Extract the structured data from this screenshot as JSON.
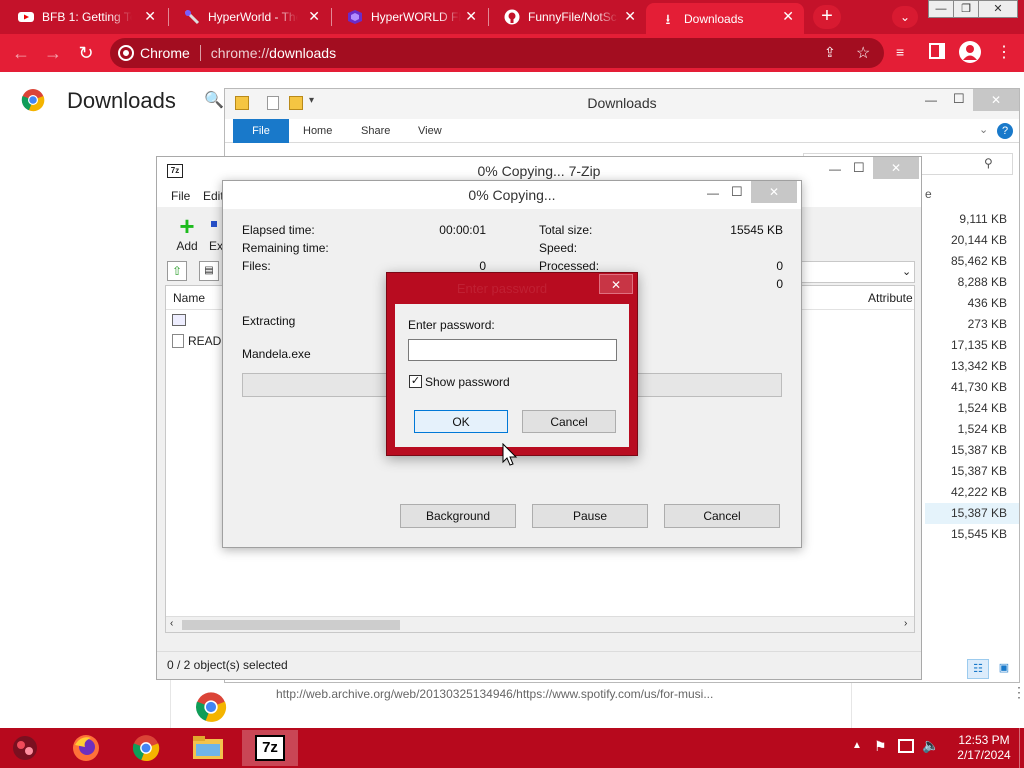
{
  "chrome": {
    "tabs": [
      {
        "title": "BFB 1: Getting Te",
        "icon": "youtube-icon"
      },
      {
        "title": "HyperWorld - The",
        "icon": "hyperworld-icon"
      },
      {
        "title": "HyperWORLD FE",
        "icon": "hyperworld-fe-icon"
      },
      {
        "title": "FunnyFile/NotSca",
        "icon": "github-icon"
      },
      {
        "title": "Downloads",
        "icon": "download-icon",
        "active": true
      }
    ],
    "site_chip": "Chrome",
    "url_prefix": "chrome://",
    "url_path": "downloads"
  },
  "downloads_page": {
    "title": "Downloads",
    "item_url": "http://web.archive.org/web/20130325134946/https://www.spotify.com/us/for-musi..."
  },
  "explorer": {
    "title": "Downloads",
    "ribbon_tabs": [
      "File",
      "Home",
      "Share",
      "View"
    ],
    "size_header": "e",
    "sizes": [
      "9,111 KB",
      "20,144 KB",
      "85,462 KB",
      "8,288 KB",
      "436 KB",
      "273 KB",
      "17,135 KB",
      "13,342 KB",
      "41,730 KB",
      "1,524 KB",
      "1,524 KB",
      "15,387 KB",
      "15,387 KB",
      "42,222 KB",
      "15,387 KB",
      "15,545 KB"
    ],
    "selected_index": 14
  },
  "zip_main": {
    "title": "0% Copying... 7-Zip",
    "menu": [
      "File",
      "Edit"
    ],
    "add_label": "Add",
    "ext_label": "Ext",
    "col_name": "Name",
    "col_attributes": "Attribute",
    "row_readme": "READM",
    "status": "0 / 2 object(s) selected"
  },
  "copy_dialog": {
    "title": "0% Copying...",
    "elapsed_label": "Elapsed time:",
    "elapsed_value": "00:00:01",
    "remaining_label": "Remaining time:",
    "files_label": "Files:",
    "files_value": "0",
    "total_size_label": "Total size:",
    "total_size_value": "15545 KB",
    "speed_label": "Speed:",
    "processed_label": "Processed:",
    "processed_value": "0",
    "extra_value": "0",
    "action": "Extracting",
    "file": "Mandela.exe",
    "progress": 0,
    "background_btn": "Background",
    "pause_btn": "Pause",
    "cancel_btn": "Cancel"
  },
  "password_dialog": {
    "title": "Enter password",
    "prompt": "Enter password:",
    "value": "",
    "show_password_label": "Show password",
    "show_password_checked": true,
    "ok_btn": "OK",
    "cancel_btn": "Cancel"
  },
  "taskbar": {
    "apps": [
      "firefox-icon",
      "chrome-icon",
      "file-explorer-icon",
      "7zip-icon"
    ],
    "active_app": "7zip-icon",
    "zip_label": "7z",
    "time": "12:53 PM",
    "date": "2/17/2024"
  },
  "colors": {
    "chrome_frame": "#c4122a",
    "chrome_toolbar": "#e41e36",
    "dialog_frame": "#b80c20",
    "taskbar": "#b7091d",
    "ribbon_file": "#1979ca"
  }
}
